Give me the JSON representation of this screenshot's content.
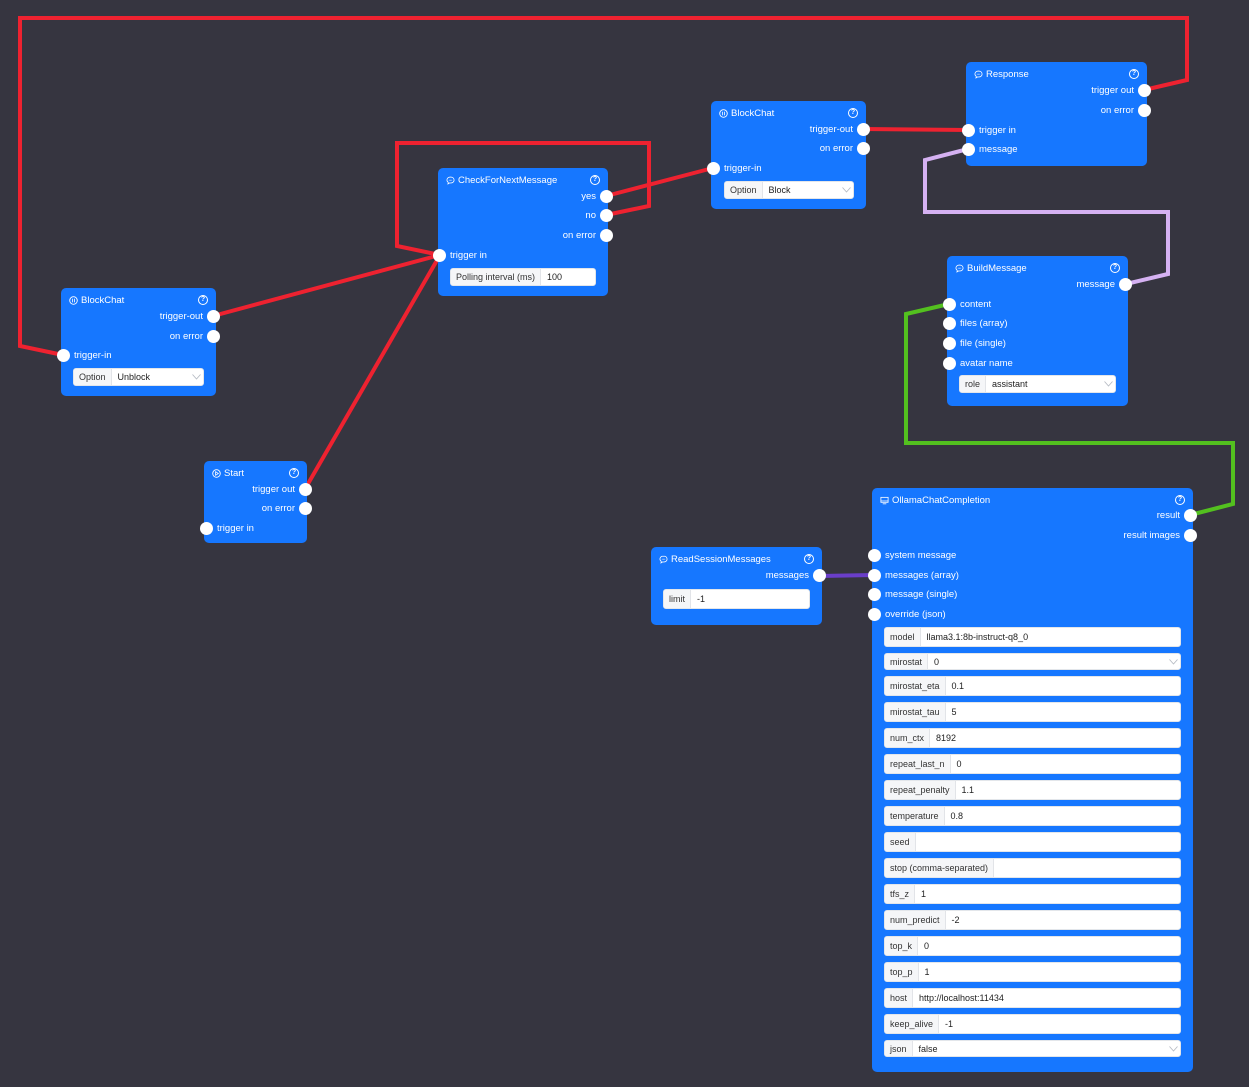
{
  "wire_colors": {
    "trigger": "#ee2230",
    "message": "#d5b1f2",
    "text": "#53c01f",
    "array": "#6a3ec9"
  },
  "node_color": "#1677ff",
  "canvas_bg": "#363540",
  "nodes": {
    "blockchat_unblock": {
      "title": "BlockChat",
      "icon": "pause-circle-icon",
      "outputs": [
        "trigger-out",
        "on error"
      ],
      "inputs": [
        "trigger-in"
      ],
      "fields": [
        {
          "label": "Option",
          "value": "Unblock",
          "type": "select"
        }
      ]
    },
    "check_next": {
      "title": "CheckForNextMessage",
      "icon": "chat-bubble-icon",
      "outputs": [
        "yes",
        "no",
        "on error"
      ],
      "inputs": [
        "trigger in"
      ],
      "fields": [
        {
          "label": "Polling interval (ms)",
          "value": "100",
          "type": "input"
        }
      ]
    },
    "blockchat_block": {
      "title": "BlockChat",
      "icon": "pause-circle-icon",
      "outputs": [
        "trigger-out",
        "on error"
      ],
      "inputs": [
        "trigger-in"
      ],
      "fields": [
        {
          "label": "Option",
          "value": "Block",
          "type": "select"
        }
      ]
    },
    "response": {
      "title": "Response",
      "icon": "chat-bubble-icon",
      "outputs": [
        "trigger out",
        "on error"
      ],
      "inputs": [
        "trigger in",
        "message"
      ],
      "fields": []
    },
    "build_message": {
      "title": "BuildMessage",
      "icon": "chat-bubble-icon",
      "outputs": [
        "message"
      ],
      "inputs": [
        "content",
        "files (array)",
        "file (single)",
        "avatar name"
      ],
      "fields": [
        {
          "label": "role",
          "value": "assistant",
          "type": "select"
        }
      ]
    },
    "start": {
      "title": "Start",
      "icon": "play-circle-icon",
      "outputs": [
        "trigger out",
        "on error"
      ],
      "inputs": [
        "trigger in"
      ],
      "fields": []
    },
    "read_session": {
      "title": "ReadSessionMessages",
      "icon": "chat-bubble-icon",
      "outputs": [
        "messages"
      ],
      "inputs": [],
      "fields": [
        {
          "label": "limit",
          "value": "-1",
          "type": "input"
        }
      ]
    },
    "ollama": {
      "title": "OllamaChatCompletion",
      "icon": "monitor-icon",
      "outputs": [
        "result",
        "result images"
      ],
      "inputs": [
        "system message",
        "messages (array)",
        "message (single)",
        "override (json)"
      ],
      "fields": [
        {
          "label": "model",
          "value": "llama3.1:8b-instruct-q8_0",
          "type": "input"
        },
        {
          "label": "mirostat",
          "value": "0",
          "type": "select"
        },
        {
          "label": "mirostat_eta",
          "value": "0.1",
          "type": "input"
        },
        {
          "label": "mirostat_tau",
          "value": "5",
          "type": "input"
        },
        {
          "label": "num_ctx",
          "value": "8192",
          "type": "input"
        },
        {
          "label": "repeat_last_n",
          "value": "0",
          "type": "input"
        },
        {
          "label": "repeat_penalty",
          "value": "1.1",
          "type": "input"
        },
        {
          "label": "temperature",
          "value": "0.8",
          "type": "input"
        },
        {
          "label": "seed",
          "value": "",
          "type": "input"
        },
        {
          "label": "stop (comma-separated)",
          "value": "",
          "type": "input"
        },
        {
          "label": "tfs_z",
          "value": "1",
          "type": "input"
        },
        {
          "label": "num_predict",
          "value": "-2",
          "type": "input"
        },
        {
          "label": "top_k",
          "value": "0",
          "type": "input"
        },
        {
          "label": "top_p",
          "value": "1",
          "type": "input"
        },
        {
          "label": "host",
          "value": "http://localhost:11434",
          "type": "input"
        },
        {
          "label": "keep_alive",
          "value": "-1",
          "type": "input"
        },
        {
          "label": "json",
          "value": "false",
          "type": "select"
        }
      ]
    }
  },
  "connections": [
    {
      "from": "response.trigger out",
      "to": "blockchat_unblock.trigger-in",
      "kind": "trigger"
    },
    {
      "from": "blockchat_unblock.trigger-out",
      "to": "check_next.trigger in",
      "kind": "trigger"
    },
    {
      "from": "start.trigger out",
      "to": "check_next.trigger in",
      "kind": "trigger"
    },
    {
      "from": "check_next.no",
      "to": "check_next.trigger in",
      "kind": "trigger"
    },
    {
      "from": "check_next.yes",
      "to": "blockchat_block.trigger-in",
      "kind": "trigger"
    },
    {
      "from": "blockchat_block.trigger-out",
      "to": "response.trigger in",
      "kind": "trigger"
    },
    {
      "from": "build_message.message",
      "to": "response.message",
      "kind": "message"
    },
    {
      "from": "ollama.result",
      "to": "build_message.content",
      "kind": "text"
    },
    {
      "from": "read_session.messages",
      "to": "ollama.messages (array)",
      "kind": "array"
    }
  ]
}
